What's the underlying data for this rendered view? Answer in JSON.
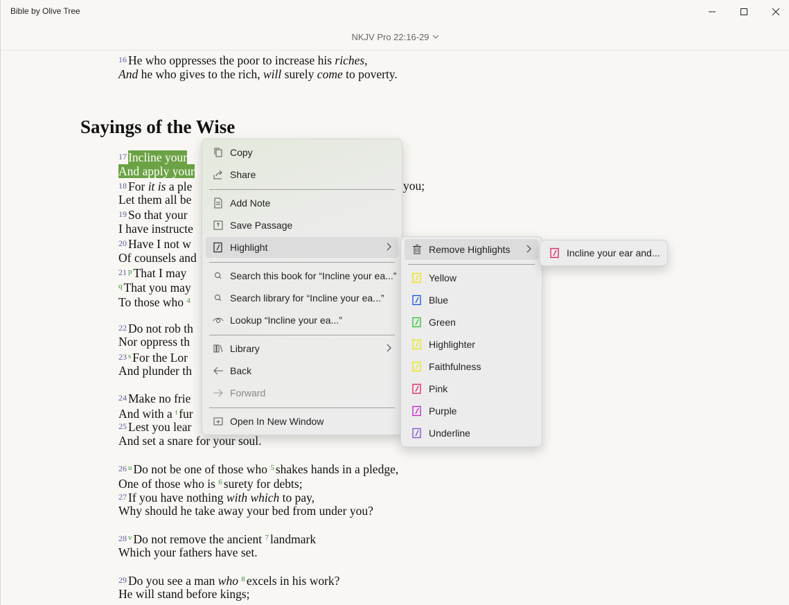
{
  "window": {
    "title": "Bible by Olive Tree",
    "controls": {
      "minimize": "minimize-icon",
      "maximize": "maximize-icon",
      "close": "close-icon"
    }
  },
  "nav": {
    "title": "NKJV Pro 22:16-29",
    "dropdown_icon": "chevron-down-icon"
  },
  "text": {
    "v16_num": "16",
    "v16_a1": "He who oppresses the poor to increase his ",
    "v16_a2": "riches,",
    "v16_b1": "And",
    "v16_b2": " he who gives to the rich, ",
    "v16_b3": "will",
    "v16_b4": " surely ",
    "v16_b5": "come",
    "v16_b6": " to poverty.",
    "heading": "Sayings of the Wise",
    "v17_num": "17",
    "v17_a": "Incline your",
    "v17_b": "And apply your",
    "v18_num": "18",
    "v18_a1": "For ",
    "v18_a2": "it is",
    "v18_a3": " a ple",
    "v18_a_end": "you;",
    "v18_b": "Let them all be",
    "v19_num": "19",
    "v19_a": "So that your",
    "v19_b": "I have instructe",
    "v20_num": "20",
    "v20_a": "Have I not w",
    "v20_b": "Of counsels and",
    "v21_num": "21",
    "v21_fn1": "p",
    "v21_a": "That I may",
    "v21_fn2": "q",
    "v21_b": "That you may",
    "v21_c": "To those who",
    "v21_fn3": "4",
    "v22_num": "22",
    "v22_a": "Do not rob th",
    "v22_b": "Nor oppress th",
    "v23_num": "23",
    "v23_fn": "s",
    "v23_a": "For the Lor",
    "v23_b": "And plunder th",
    "v24_num": "24",
    "v24_a": "Make no frie",
    "v24_b1": "And with a ",
    "v24_fn": "t",
    "v24_b2": "fur",
    "v25_num": "25",
    "v25_a": "Lest you lear",
    "v25_b": "And set a snare for your soul.",
    "v26_num": "26",
    "v26_fn1": "u",
    "v26_a1": "Do not be one of those who ",
    "v26_fn2": "5",
    "v26_a2": "shakes hands in a pledge,",
    "v26_b1": "One of those who is ",
    "v26_fn3": "6",
    "v26_b2": "surety for debts;",
    "v27_num": "27",
    "v27_a1": "If you have nothing ",
    "v27_a2": "with which",
    "v27_a3": " to pay,",
    "v27_b": "Why should he take away your bed from under you?",
    "v28_num": "28",
    "v28_fn1": "v",
    "v28_a1": "Do not remove the ancient ",
    "v28_fn2": "7",
    "v28_a2": "landmark",
    "v28_b": "Which your fathers have set.",
    "v29_num": "29",
    "v29_a1": "Do you see a man ",
    "v29_a2": "who",
    "v29_fn": "8",
    "v29_a3": "excels in his work?",
    "v29_b": "He will stand before kings;"
  },
  "context_menu": {
    "items": [
      {
        "label": "Copy",
        "icon": "copy-icon"
      },
      {
        "label": "Share",
        "icon": "share-icon"
      },
      {
        "label": "Add Note",
        "icon": "note-icon"
      },
      {
        "label": "Save Passage",
        "icon": "save-passage-icon"
      },
      {
        "label": "Highlight",
        "icon": "highlight-icon"
      },
      {
        "label": "Search this book for “Incline your ea...”",
        "icon": "search-icon"
      },
      {
        "label": "Search library for “Incline your ea...”",
        "icon": "search-icon"
      },
      {
        "label": "Lookup “Incline your ea...”",
        "icon": "lookup-icon"
      },
      {
        "label": "Library",
        "icon": "library-icon"
      },
      {
        "label": "Back",
        "icon": "back-arrow-icon"
      },
      {
        "label": "Forward",
        "icon": "forward-arrow-icon"
      },
      {
        "label": "Open In New Window",
        "icon": "new-window-icon"
      }
    ]
  },
  "highlight_menu": {
    "remove_label": "Remove Highlights",
    "colors": [
      {
        "label": "Yellow",
        "color": "#e6e600"
      },
      {
        "label": "Blue",
        "color": "#1f4fd8"
      },
      {
        "label": "Green",
        "color": "#22c02a"
      },
      {
        "label": "Highlighter",
        "color": "#e8e800"
      },
      {
        "label": "Faithfulness",
        "color": "#e8e800"
      },
      {
        "label": "Pink",
        "color": "#e0205a"
      },
      {
        "label": "Purple",
        "color": "#c020c8"
      },
      {
        "label": "Underline",
        "color": "#7a4ad0"
      }
    ]
  },
  "remove_menu": {
    "item_label": "Incline your ear and...",
    "color": "#e0205a"
  },
  "colors": {
    "highlight_bg": "#6ba244",
    "verse_number": "#5b5fa0",
    "footnote": "#3f8e3f",
    "background": "#f8f7f3"
  }
}
